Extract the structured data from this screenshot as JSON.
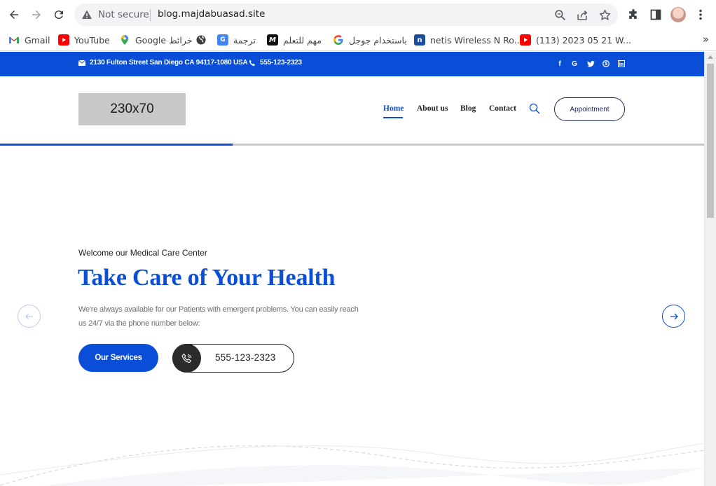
{
  "browser": {
    "not_secure_label": "Not secure",
    "url": "blog.majdabuasad.site",
    "bookmarks": [
      {
        "label": "Gmail",
        "icon": "gmail-icon"
      },
      {
        "label": "YouTube",
        "icon": "youtube-icon"
      },
      {
        "label": "Google خرائط",
        "icon": "google-maps-icon"
      },
      {
        "label": "",
        "icon": "globe-icon"
      },
      {
        "label": "ترجمة",
        "icon": "google-translate-icon"
      },
      {
        "label": "مهم للتعلم",
        "icon": "m-logo-icon"
      },
      {
        "label": "باستخدام جوجل",
        "icon": "google-icon"
      },
      {
        "label": "netis Wireless N Ro...",
        "icon": "netis-icon"
      },
      {
        "label": "(113) 2023 05 21 W...",
        "icon": "youtube-icon"
      }
    ],
    "more_bookmarks": "»"
  },
  "topbar": {
    "address": "2130 Fulton Street San Diego CA 94117-1080 USA",
    "phone": "555-123-2323",
    "social": [
      "f",
      "G",
      "t",
      "s",
      "in"
    ]
  },
  "header": {
    "logo_text": "230x70",
    "menu": [
      "Home",
      "About us",
      "Blog",
      "Contact"
    ],
    "appointment_label": "Appointment"
  },
  "slider_progress": 0.33,
  "hero": {
    "welcome": "Welcome our Medical Care Center",
    "title": "Take Care of Your Health",
    "description": "We're always available for our Patients with emergent problems. You can easily reach us 24/7 via the phone number below:",
    "services_label": "Our Services",
    "phone": "555-123-2323"
  },
  "colors": {
    "brand_blue": "#0a4ed8",
    "chrome_bg": "#f1f3f4"
  }
}
